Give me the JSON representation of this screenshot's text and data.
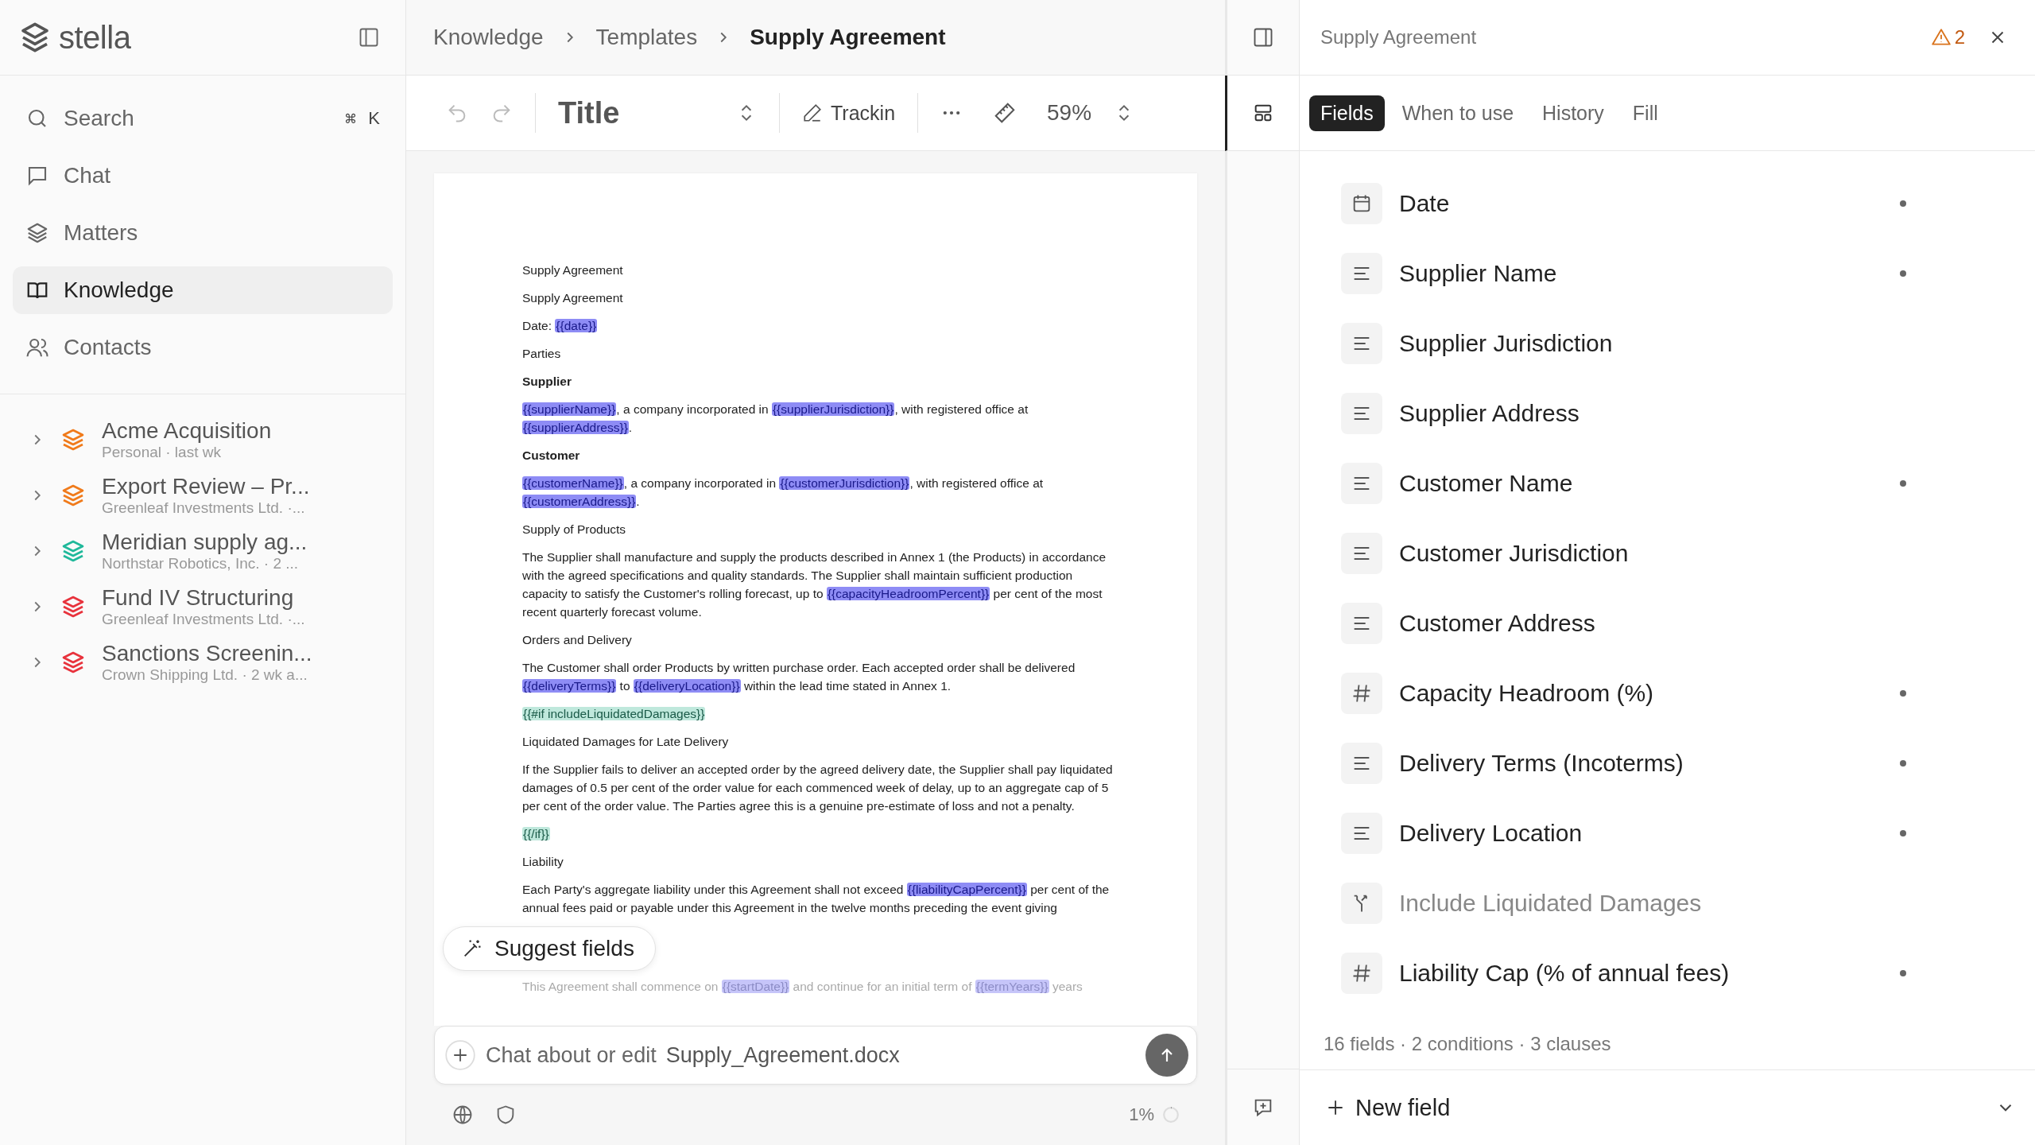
{
  "sidebar": {
    "brand": "stella",
    "nav": [
      {
        "label": "Search",
        "kind": "search",
        "shortcut": [
          "⌘",
          "K"
        ],
        "selected": false
      },
      {
        "label": "Chat",
        "kind": "chat",
        "selected": false
      },
      {
        "label": "Matters",
        "kind": "matters",
        "selected": false
      },
      {
        "label": "Knowledge",
        "kind": "knowledge",
        "selected": true
      },
      {
        "label": "Contacts",
        "kind": "contacts",
        "selected": false
      }
    ],
    "matters": [
      {
        "name": "Acme Acquisition",
        "meta": "Personal · last wk",
        "color": "#f07a1a"
      },
      {
        "name": "Export Review – Pr...",
        "meta": "Greenleaf Investments Ltd. ·...",
        "color": "#f07a1a"
      },
      {
        "name": "Meridian supply ag...",
        "meta": "Northstar Robotics, Inc. · 2 ...",
        "color": "#1fb89a"
      },
      {
        "name": "Fund IV Structuring",
        "meta": "Greenleaf Investments Ltd. ·...",
        "color": "#e8323c"
      },
      {
        "name": "Sanctions Screenin...",
        "meta": "Crown Shipping Ltd. · 2 wk a...",
        "color": "#e8323c"
      }
    ]
  },
  "breadcrumb": [
    {
      "label": "Knowledge",
      "current": false
    },
    {
      "label": "Templates",
      "current": false
    },
    {
      "label": "Supply Agreement",
      "current": true
    }
  ],
  "toolbar": {
    "undo_disabled": true,
    "redo_disabled": true,
    "style": "Title",
    "tracking": "Trackin",
    "zoom": "59%"
  },
  "document": {
    "paragraphs": [
      {
        "kind": "plain",
        "segments": [
          {
            "kind": "text",
            "text": "Supply Agreement"
          }
        ]
      },
      {
        "kind": "plain",
        "segments": [
          {
            "kind": "text",
            "text": "Supply Agreement"
          }
        ]
      },
      {
        "kind": "plain",
        "segments": [
          {
            "kind": "text",
            "text": "Date: "
          },
          {
            "kind": "var",
            "text": "{{date}}"
          }
        ]
      },
      {
        "kind": "plain",
        "segments": [
          {
            "kind": "text",
            "text": "Parties"
          }
        ]
      },
      {
        "kind": "bold",
        "segments": [
          {
            "kind": "text",
            "text": "Supplier"
          }
        ]
      },
      {
        "kind": "plain",
        "segments": [
          {
            "kind": "var",
            "text": "{{supplierName}}"
          },
          {
            "kind": "text",
            "text": ", a company incorporated in "
          },
          {
            "kind": "var",
            "text": "{{supplierJurisdiction}}"
          },
          {
            "kind": "text",
            "text": ", with registered office at "
          },
          {
            "kind": "var",
            "text": "{{supplierAddress}}"
          },
          {
            "kind": "text",
            "text": "."
          }
        ]
      },
      {
        "kind": "bold",
        "segments": [
          {
            "kind": "text",
            "text": "Customer"
          }
        ]
      },
      {
        "kind": "plain",
        "segments": [
          {
            "kind": "var",
            "text": "{{customerName}}"
          },
          {
            "kind": "text",
            "text": ", a company incorporated in "
          },
          {
            "kind": "var",
            "text": "{{customerJurisdiction}}"
          },
          {
            "kind": "text",
            "text": ", with registered office at "
          },
          {
            "kind": "var",
            "text": "{{customerAddress}}"
          },
          {
            "kind": "text",
            "text": "."
          }
        ]
      },
      {
        "kind": "plain",
        "segments": [
          {
            "kind": "text",
            "text": "Supply of Products"
          }
        ]
      },
      {
        "kind": "plain",
        "segments": [
          {
            "kind": "text",
            "text": "The Supplier shall manufacture and supply the products described in Annex 1 (the Products) in accordance with the agreed specifications and quality standards. The Supplier shall maintain sufficient production capacity to satisfy the Customer's rolling forecast, up to "
          },
          {
            "kind": "var",
            "text": "{{capacityHeadroomPercent}}"
          },
          {
            "kind": "text",
            "text": " per cent of the most recent quarterly forecast volume."
          }
        ]
      },
      {
        "kind": "plain",
        "segments": [
          {
            "kind": "text",
            "text": "Orders and Delivery"
          }
        ]
      },
      {
        "kind": "plain",
        "segments": [
          {
            "kind": "text",
            "text": "The Customer shall order Products by written purchase order. Each accepted order shall be delivered "
          },
          {
            "kind": "var",
            "text": "{{deliveryTerms}}"
          },
          {
            "kind": "text",
            "text": " to "
          },
          {
            "kind": "var",
            "text": "{{deliveryLocation}}"
          },
          {
            "kind": "text",
            "text": " within the lead time stated in Annex 1."
          }
        ]
      },
      {
        "kind": "conditional",
        "segments": [
          {
            "kind": "cond",
            "text": "{{#if includeLiquidatedDamages}}"
          }
        ]
      },
      {
        "kind": "conditional",
        "segments": [
          {
            "kind": "text",
            "text": "Liquidated Damages for Late Delivery"
          }
        ]
      },
      {
        "kind": "conditional",
        "segments": [
          {
            "kind": "text",
            "text": "If the Supplier fails to deliver an accepted order by the agreed delivery date, the Supplier shall pay liquidated damages of 0.5 per cent of the order value for each commenced week of delay, up to an aggregate cap of 5 per cent of the order value. The Parties agree this is a genuine pre-estimate of loss and not a penalty."
          }
        ]
      },
      {
        "kind": "conditional",
        "segments": [
          {
            "kind": "cond",
            "text": "{{/if}}"
          }
        ]
      },
      {
        "kind": "plain",
        "segments": [
          {
            "kind": "text",
            "text": "Liability"
          }
        ]
      },
      {
        "kind": "plain",
        "segments": [
          {
            "kind": "text",
            "text": "Each Party's aggregate liability under this Agreement shall not exceed "
          },
          {
            "kind": "var",
            "text": "{{liabilityCapPercent}}"
          },
          {
            "kind": "text",
            "text": " per cent of the annual fees paid or payable under this Agreement in the twelve months preceding the event giving"
          }
        ]
      },
      {
        "kind": "faded",
        "segments": [
          {
            "kind": "text",
            "text": "This Agreement shall commence on "
          },
          {
            "kind": "var",
            "text": "{{startDate}}"
          },
          {
            "kind": "text",
            "text": " and continue for an initial term of "
          },
          {
            "kind": "var",
            "text": "{{termYears}}"
          },
          {
            "kind": "text",
            "text": " years"
          }
        ]
      }
    ]
  },
  "suggest_button": "Suggest fields",
  "chat": {
    "placeholder": "Chat about or edit",
    "file": "Supply_Agreement.docx"
  },
  "context": {
    "reading": "1%",
    "level": 0.01
  },
  "panel": {
    "title": "Supply Agreement",
    "warnings": "2",
    "tabs": [
      {
        "label": "Fields",
        "selected": true
      },
      {
        "label": "When to use",
        "selected": false
      },
      {
        "label": "History",
        "selected": false
      },
      {
        "label": "Fill",
        "selected": false
      }
    ],
    "fields": [
      {
        "label": "Date",
        "kind": "date",
        "required": true
      },
      {
        "label": "Supplier Name",
        "kind": "text",
        "required": true
      },
      {
        "label": "Supplier Jurisdiction",
        "kind": "text",
        "required": false
      },
      {
        "label": "Supplier Address",
        "kind": "text",
        "required": false
      },
      {
        "label": "Customer Name",
        "kind": "text",
        "required": true
      },
      {
        "label": "Customer Jurisdiction",
        "kind": "text",
        "required": false
      },
      {
        "label": "Customer Address",
        "kind": "text",
        "required": false
      },
      {
        "label": "Capacity Headroom (%)",
        "kind": "number",
        "required": true
      },
      {
        "label": "Delivery Terms (Incoterms)",
        "kind": "text",
        "required": true
      },
      {
        "label": "Delivery Location",
        "kind": "text",
        "required": true
      },
      {
        "label": "Include Liquidated Damages",
        "kind": "condition",
        "required": false
      },
      {
        "label": "Liability Cap (% of annual fees)",
        "kind": "number",
        "required": true
      }
    ],
    "summary": "16 fields · 2 conditions · 3 clauses",
    "new_field": "New field"
  }
}
